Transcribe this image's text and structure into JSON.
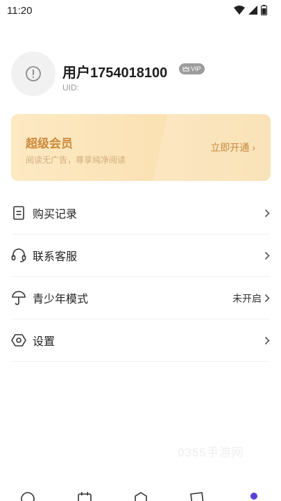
{
  "status_bar": {
    "time": "11:20"
  },
  "profile": {
    "username": "用户1754018100",
    "vip_badge": "VIP",
    "uid_label": "UID:"
  },
  "vip_card": {
    "title": "超级会员",
    "subtitle": "阅读无广告，尊享纯净阅读",
    "open_label": "立即开通 ›"
  },
  "menu": {
    "items": [
      {
        "label": "购买记录",
        "icon": "receipt-icon",
        "value": ""
      },
      {
        "label": "联系客服",
        "icon": "headset-icon",
        "value": ""
      },
      {
        "label": "青少年模式",
        "icon": "umbrella-icon",
        "value": "未开启"
      },
      {
        "label": "设置",
        "icon": "settings-hexagon-icon",
        "value": ""
      }
    ]
  },
  "watermark": "0355手游网",
  "colors": {
    "vip_gold": "#cd8a3a",
    "vip_card_bg": "#fde9c3",
    "tab_active": "#5b3fd6",
    "text_primary": "#222222",
    "text_secondary": "#9a9a9a"
  }
}
